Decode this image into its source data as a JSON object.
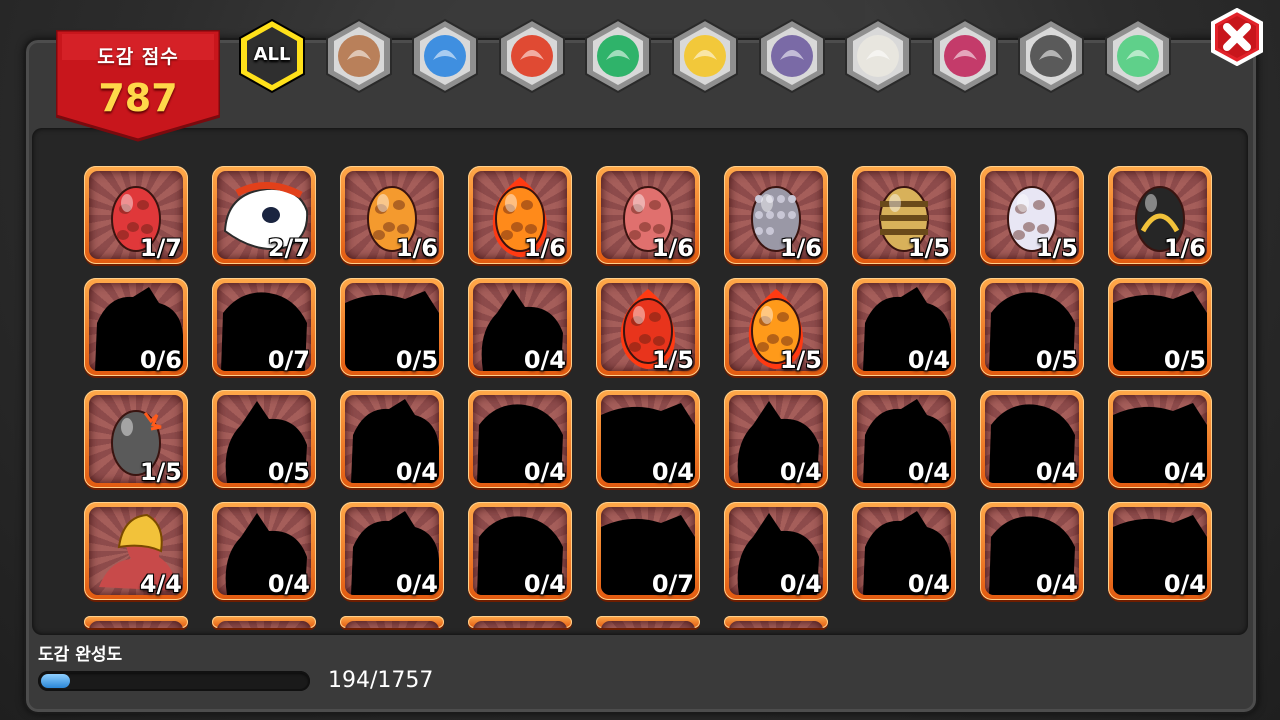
{
  "score": {
    "label": "도감 점수",
    "value": "787"
  },
  "tabs": [
    {
      "name": "tab-all",
      "label": "ALL",
      "active": true,
      "color": "#3a3a3a",
      "icon": "all-icon"
    },
    {
      "name": "tab-earth",
      "label": "",
      "active": false,
      "color": "#b9805a",
      "icon": "earth-element-icon"
    },
    {
      "name": "tab-water",
      "label": "",
      "active": false,
      "color": "#3f8fe0",
      "icon": "water-element-icon"
    },
    {
      "name": "tab-fire",
      "label": "",
      "active": false,
      "color": "#e04a33",
      "icon": "fire-element-icon"
    },
    {
      "name": "tab-wind",
      "label": "",
      "active": false,
      "color": "#2fb36a",
      "icon": "wind-element-icon"
    },
    {
      "name": "tab-light",
      "label": "",
      "active": false,
      "color": "#f2c83a",
      "icon": "light-element-icon"
    },
    {
      "name": "tab-dark",
      "label": "",
      "active": false,
      "color": "#7a6aa6",
      "icon": "dark-element-icon"
    },
    {
      "name": "tab-metal",
      "label": "",
      "active": false,
      "color": "#e8e6df",
      "icon": "metal-element-icon"
    },
    {
      "name": "tab-chaos",
      "label": "",
      "active": false,
      "color": "#c43b6a",
      "icon": "chaos-element-icon"
    },
    {
      "name": "tab-shadow",
      "label": "",
      "active": false,
      "color": "#5a5a5a",
      "icon": "shadow-element-icon"
    },
    {
      "name": "tab-rainbow",
      "label": "",
      "active": false,
      "color": "#5fd08a",
      "icon": "rainbow-element-icon"
    }
  ],
  "grid": {
    "rows": [
      [
        {
          "count": "1/7",
          "kind": "egg",
          "color": "#e0383a"
        },
        {
          "count": "2/7",
          "kind": "creature",
          "color": "#ffffff"
        },
        {
          "count": "1/6",
          "kind": "egg",
          "color": "#f49a2e"
        },
        {
          "count": "1/6",
          "kind": "fire-egg",
          "color": "#ff8a1a"
        },
        {
          "count": "1/6",
          "kind": "egg",
          "color": "#e0706e"
        },
        {
          "count": "1/6",
          "kind": "spiky-egg",
          "color": "#9a98a6"
        },
        {
          "count": "1/5",
          "kind": "striped-egg",
          "color": "#d8b15a"
        },
        {
          "count": "1/5",
          "kind": "egg",
          "color": "#e8e6f4"
        },
        {
          "count": "1/6",
          "kind": "dark-egg",
          "color": "#262626"
        }
      ],
      [
        {
          "count": "0/6",
          "kind": "silhouette"
        },
        {
          "count": "0/7",
          "kind": "silhouette"
        },
        {
          "count": "0/5",
          "kind": "silhouette"
        },
        {
          "count": "0/4",
          "kind": "silhouette"
        },
        {
          "count": "1/5",
          "kind": "fire-egg",
          "color": "#e8341c"
        },
        {
          "count": "1/5",
          "kind": "fire-egg",
          "color": "#ff9a1a"
        },
        {
          "count": "0/4",
          "kind": "silhouette"
        },
        {
          "count": "0/5",
          "kind": "silhouette"
        },
        {
          "count": "0/5",
          "kind": "silhouette"
        }
      ],
      [
        {
          "count": "1/5",
          "kind": "bomb-egg",
          "color": "#5a5a5a"
        },
        {
          "count": "0/5",
          "kind": "silhouette"
        },
        {
          "count": "0/4",
          "kind": "silhouette"
        },
        {
          "count": "0/4",
          "kind": "silhouette"
        },
        {
          "count": "0/4",
          "kind": "silhouette"
        },
        {
          "count": "0/4",
          "kind": "silhouette"
        },
        {
          "count": "0/4",
          "kind": "silhouette"
        },
        {
          "count": "0/4",
          "kind": "silhouette"
        },
        {
          "count": "0/4",
          "kind": "silhouette"
        }
      ],
      [
        {
          "count": "4/4",
          "kind": "dragon",
          "color": "#f2c23a"
        },
        {
          "count": "0/4",
          "kind": "silhouette"
        },
        {
          "count": "0/4",
          "kind": "silhouette"
        },
        {
          "count": "0/4",
          "kind": "silhouette"
        },
        {
          "count": "0/7",
          "kind": "silhouette"
        },
        {
          "count": "0/4",
          "kind": "silhouette"
        },
        {
          "count": "0/4",
          "kind": "silhouette"
        },
        {
          "count": "0/4",
          "kind": "silhouette"
        },
        {
          "count": "0/4",
          "kind": "silhouette"
        }
      ]
    ],
    "partial_row_count": 6
  },
  "completion": {
    "label": "도감 완성도",
    "text": "194/1757",
    "fraction": 0.1104
  },
  "colors": {
    "frame": "#f07a1c",
    "banner": "#c8161c",
    "score": "#ffd84a",
    "progress": "#2a86d6"
  }
}
